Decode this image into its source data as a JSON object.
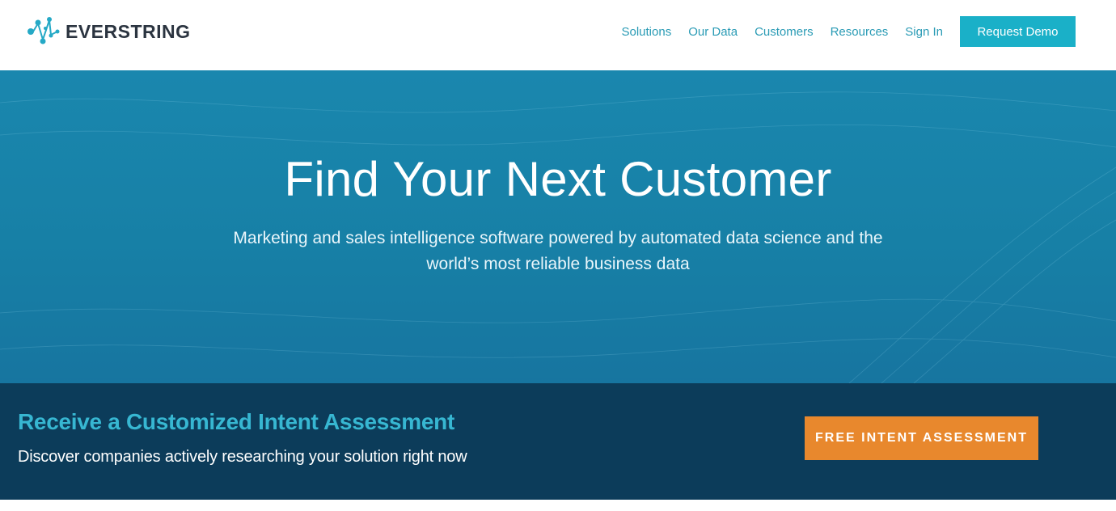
{
  "brand": {
    "name": "EVERSTRING",
    "logo_icon": "everstring-node-icon",
    "accent_color": "#1ab0c8"
  },
  "nav": {
    "items": [
      "Solutions",
      "Our Data",
      "Customers",
      "Resources",
      "Sign In"
    ],
    "cta_label": "Request Demo",
    "link_color": "#2a9bb5"
  },
  "hero": {
    "title": "Find Your Next Customer",
    "subtitle_line1": "Marketing and sales intelligence software powered by automated data science and the",
    "subtitle_line2": "world’s most reliable business data",
    "background_color": "#1a87ae"
  },
  "banner": {
    "title": "Receive a Customized Intent Assessment",
    "subtitle": "Discover companies actively researching your solution right now",
    "cta_label": "FREE INTENT ASSESSMENT",
    "background_color": "#0c3c5a",
    "cta_color": "#e8882d"
  }
}
